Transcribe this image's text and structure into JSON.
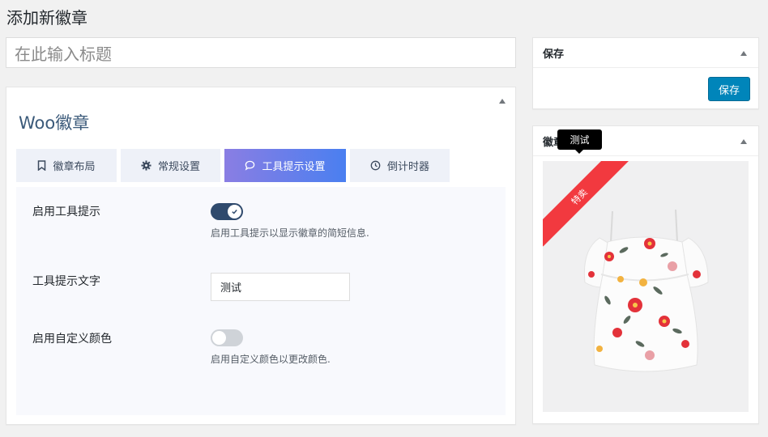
{
  "page": {
    "title": "添加新徽章"
  },
  "title_input": {
    "placeholder": "在此输入标题"
  },
  "main": {
    "heading": "Woo徽章",
    "tabs": [
      {
        "label": "徽章布局",
        "icon": "bookmark-icon",
        "active": false
      },
      {
        "label": "常规设置",
        "icon": "gear-icon",
        "active": false
      },
      {
        "label": "工具提示设置",
        "icon": "speech-bubble-icon",
        "active": true
      },
      {
        "label": "倒计时器",
        "icon": "clock-icon",
        "active": false
      }
    ],
    "settings": {
      "enable_tooltip_label": "启用工具提示",
      "enable_tooltip_on": true,
      "enable_tooltip_help": "启用工具提示以显示徽章的简短信息.",
      "tooltip_text_label": "工具提示文字",
      "tooltip_text_value": "测试",
      "custom_color_label": "启用自定义颜色",
      "custom_color_on": false,
      "custom_color_help": "启用自定义颜色以更改颜色."
    }
  },
  "save_box": {
    "title": "保存",
    "button": "保存"
  },
  "preview_box": {
    "title": "徽章",
    "tooltip": "测试",
    "ribbon": "特卖"
  },
  "colors": {
    "primary_button": "#0085ba",
    "active_tab_from": "#8a7ee3",
    "active_tab_to": "#4a7ff0",
    "toggle_on": "#2f4a6d",
    "ribbon": "#f2393f"
  }
}
